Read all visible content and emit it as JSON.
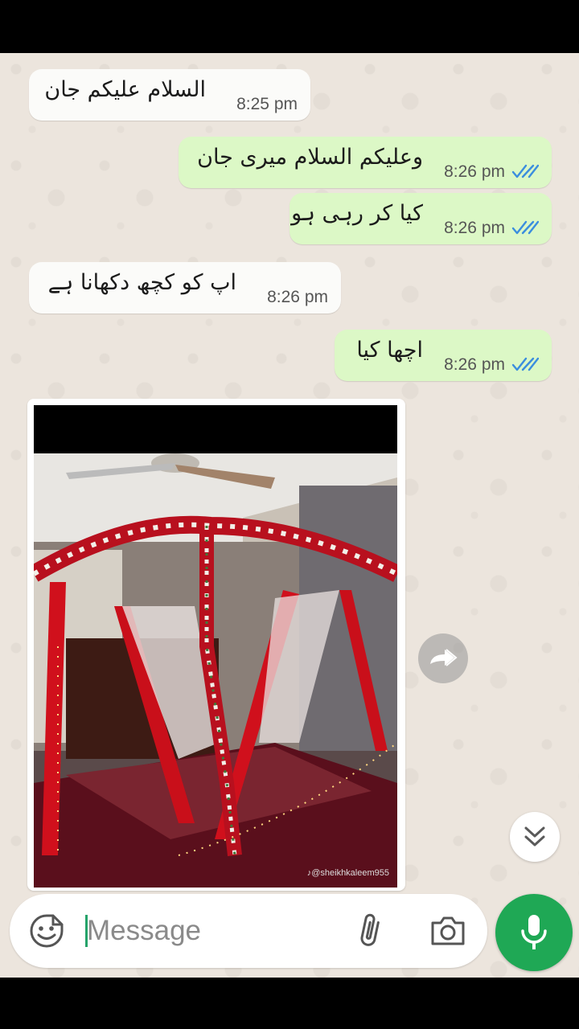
{
  "messages": [
    {
      "direction": "incoming",
      "text": "السلام علیکم جان",
      "time": "8:25 pm"
    },
    {
      "direction": "outgoing",
      "text": "وعلیکم السلام میری جان",
      "time": "8:26 pm",
      "status": "read"
    },
    {
      "direction": "outgoing",
      "text": "کیا کر رہی ہو",
      "time": "8:26 pm",
      "status": "read"
    },
    {
      "direction": "incoming",
      "text": "اپ کو کچھ دکھانا ہے",
      "time": "8:26 pm"
    },
    {
      "direction": "outgoing",
      "text": "اچھا کیا",
      "time": "8:26 pm",
      "status": "read"
    }
  ],
  "image_message": {
    "direction": "incoming",
    "watermark": "♪@sheikhkaleem955"
  },
  "composer": {
    "placeholder": "Message",
    "left_icon": "sticker-icon",
    "icons": [
      "attach-icon",
      "camera-icon"
    ]
  },
  "buttons": {
    "forward_icon": "forward-icon",
    "scroll_down_icon": "double-chevron-down-icon",
    "mic_icon": "mic-icon"
  },
  "colors": {
    "outgoing_bubble": "#dcf8c6",
    "incoming_bubble": "#fbfbf9",
    "read_ticks": "#3b8ede",
    "mic_button": "#1fa855",
    "chat_background": "#ece5dd"
  }
}
